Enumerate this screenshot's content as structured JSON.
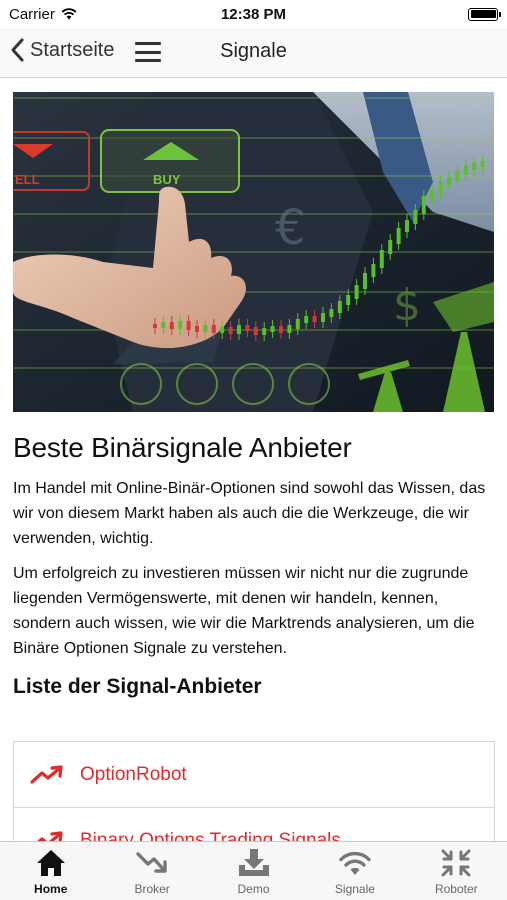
{
  "status_bar": {
    "carrier": "Carrier",
    "time": "12:38 PM"
  },
  "nav": {
    "back_label": "Startseite",
    "title": "Signale"
  },
  "hero": {
    "sell_label": "ELL",
    "buy_label": "BUY"
  },
  "article": {
    "headline": "Beste Binärsignale Anbieter",
    "paragraph1": "Im Handel mit Online-Binär-Optionen sind sowohl das Wissen, das wir von diesem Markt haben als auch die die Werkzeuge, die wir verwenden, wichtig.",
    "paragraph2": "Um erfolgreich zu investieren müssen wir nicht nur die zugrunde liegenden Vermögenswerte, mit denen wir handeln, kennen, sondern auch wissen, wie wir die Marktrends analysieren, um die Binäre Optionen Signale zu verstehen.",
    "list_title": "Liste der Signal-Anbieter"
  },
  "providers": [
    {
      "label": "OptionRobot",
      "icon": "trending-up-icon"
    },
    {
      "label": "Binary Options Trading Signals",
      "icon": "trending-up-icon"
    }
  ],
  "tabs": [
    {
      "label": "Home",
      "icon": "home-icon",
      "active": true
    },
    {
      "label": "Broker",
      "icon": "trending-down-icon",
      "active": false
    },
    {
      "label": "Demo",
      "icon": "download-tray-icon",
      "active": false
    },
    {
      "label": "Signale",
      "icon": "wifi-icon",
      "active": false
    },
    {
      "label": "Roboter",
      "icon": "compress-arrows-icon",
      "active": false
    }
  ],
  "colors": {
    "accent_red": "#e02b2b",
    "hero_green": "#7cc243"
  }
}
